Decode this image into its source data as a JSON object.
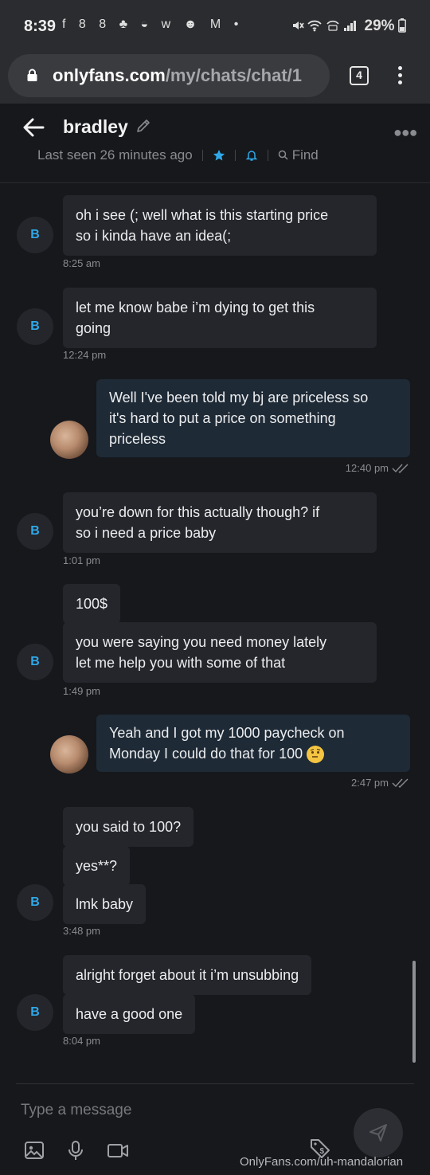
{
  "status_bar": {
    "time": "8:39",
    "notification_icons": "f 8 8 ♣ ◒ w ☻ M •",
    "battery": "29%"
  },
  "browser": {
    "url_domain": "onlyfans.com",
    "url_path": "/my/chats/chat/1",
    "tab_count": "4"
  },
  "chat_header": {
    "name": "bradley",
    "last_seen": "Last seen 26 minutes ago",
    "find_label": "Find"
  },
  "messages": [
    {
      "id": "m1",
      "from": "them",
      "avatar": "B",
      "lines": [
        "oh i see (; well what is this starting price",
        "so i kinda have an idea(;"
      ],
      "time": "8:25 am"
    },
    {
      "id": "m2",
      "from": "them",
      "avatar": "B",
      "lines": [
        "let me know babe i’m dying to get this",
        "going"
      ],
      "time": "12:24 pm"
    },
    {
      "id": "m3",
      "from": "me",
      "lines": [
        "Well I've been told my bj are priceless so",
        "it's hard to put a price on something",
        "priceless"
      ],
      "time": "12:40 pm"
    },
    {
      "id": "m4",
      "from": "them",
      "avatar": "B",
      "lines": [
        "you’re down for this actually though? if",
        "so i need a price baby"
      ],
      "time": "1:01 pm"
    },
    {
      "id": "m5a",
      "from": "them",
      "lines": [
        "100$"
      ]
    },
    {
      "id": "m5b",
      "from": "them",
      "avatar": "B",
      "lines": [
        "you were saying you need money lately",
        "let me help you with some of that"
      ],
      "time": "1:49 pm"
    },
    {
      "id": "m6",
      "from": "me",
      "lines": [
        "Yeah and I got my 1000 paycheck on",
        "Monday I could do that for 100"
      ],
      "time": "2:47 pm"
    },
    {
      "id": "m7a",
      "from": "them",
      "lines": [
        "you said to 100?"
      ]
    },
    {
      "id": "m7b",
      "from": "them",
      "lines": [
        "yes**?"
      ]
    },
    {
      "id": "m7c",
      "from": "them",
      "avatar": "B",
      "lines": [
        "lmk baby"
      ],
      "time": "3:48 pm"
    },
    {
      "id": "m8a",
      "from": "them",
      "lines": [
        "alright forget about it i’m unsubbing"
      ]
    },
    {
      "id": "m8b",
      "from": "them",
      "avatar": "B",
      "lines": [
        "have a good one"
      ],
      "time": "8:04 pm"
    }
  ],
  "composer": {
    "placeholder": "Type a message"
  },
  "watermark": "OnlyFans.com/uh-mandalorian",
  "colors": {
    "background": "#17181c",
    "incoming_bubble": "#25262b",
    "outgoing_bubble": "#1e2a36",
    "accent_blue": "#2fa8e8"
  }
}
